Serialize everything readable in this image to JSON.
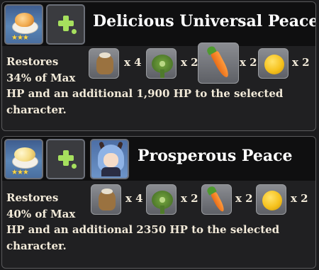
{
  "recipes": [
    {
      "title": "Delicious Universal Peace",
      "stars": "★★★",
      "description": [
        "Restores",
        "34% of Max",
        "HP and an additional 1,900 HP to the selected",
        "character."
      ],
      "ingredients": [
        {
          "icon": "flour-sack-icon",
          "qty": "x 4"
        },
        {
          "icon": "lotus-head-icon",
          "qty": "x 2"
        },
        {
          "icon": "carrot-icon",
          "qty": "x 2"
        },
        {
          "icon": "sunsettia-icon",
          "qty": "x 2"
        }
      ]
    },
    {
      "title": "Prosperous Peace",
      "stars": "★★★",
      "character_portrait": "character-portrait-icon",
      "description": [
        "Restores",
        "40% of Max",
        "HP and an additional 2350 HP to the selected",
        "character."
      ],
      "ingredients": [
        {
          "icon": "flour-sack-icon",
          "qty": "x 4"
        },
        {
          "icon": "lotus-head-icon",
          "qty": "x 2"
        },
        {
          "icon": "carrot-icon",
          "qty": "x 2"
        },
        {
          "icon": "sunsettia-icon",
          "qty": "x 2"
        }
      ]
    }
  ]
}
